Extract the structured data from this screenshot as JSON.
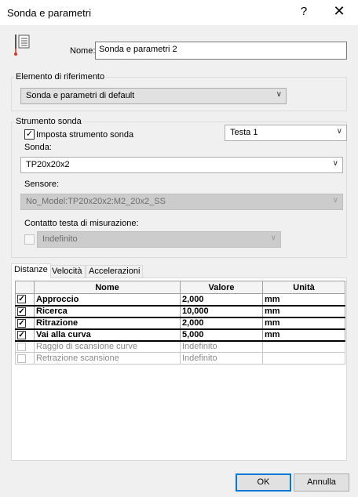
{
  "window": {
    "title": "Sonda e parametri",
    "help": "?",
    "close": "✕"
  },
  "name_field": {
    "label": "Nome:",
    "value": "Sonda e parametri 2"
  },
  "reference_group": {
    "title": "Elemento di riferimento",
    "combo_value": "Sonda e parametri di default"
  },
  "probe_group": {
    "title": "Strumento sonda",
    "set_probe_label": "Imposta strumento sonda",
    "set_probe_checked": true,
    "head_value": "Testa 1",
    "probe_label": "Sonda:",
    "probe_value": "TP20x20x2",
    "sensor_label": "Sensore:",
    "sensor_value": "No_Model:TP20x20x2:M2_20x2_SS",
    "contact_label": "Contatto testa di misurazione:",
    "contact_value": "Indefinito"
  },
  "tabs": [
    {
      "label": "Distanze",
      "active": true
    },
    {
      "label": "Velocità",
      "active": false
    },
    {
      "label": "Accelerazioni",
      "active": false
    }
  ],
  "table": {
    "headers": [
      "Nome",
      "Valore",
      "Unità"
    ],
    "rows": [
      {
        "checked": true,
        "name": "Approccio",
        "value": "2,000",
        "unit": "mm",
        "enabled": true
      },
      {
        "checked": true,
        "name": "Ricerca",
        "value": "10,000",
        "unit": "mm",
        "enabled": true
      },
      {
        "checked": true,
        "name": "Ritrazione",
        "value": "2,000",
        "unit": "mm",
        "enabled": true
      },
      {
        "checked": true,
        "name": "Vai alla curva",
        "value": "5,000",
        "unit": "mm",
        "enabled": true
      },
      {
        "checked": false,
        "name": "Raggio di scansione curve",
        "value": "Indefinito",
        "unit": "",
        "enabled": false
      },
      {
        "checked": false,
        "name": "Retrazione scansione",
        "value": "Indefinito",
        "unit": "",
        "enabled": false
      }
    ]
  },
  "buttons": {
    "ok": "OK",
    "cancel": "Annulla"
  }
}
